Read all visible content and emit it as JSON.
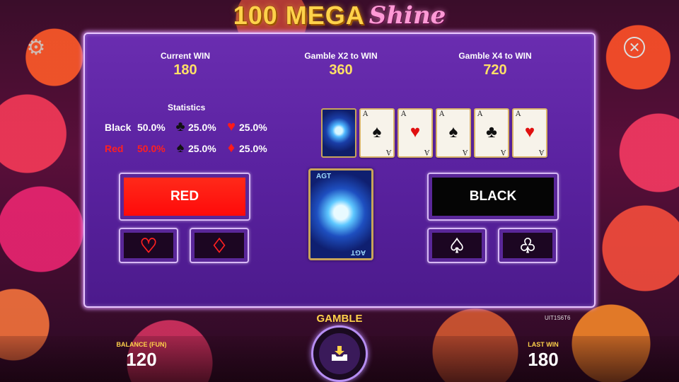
{
  "logo": {
    "part1": "100 MEGA",
    "part2": "Shine"
  },
  "header": {
    "current_win_label": "Current WIN",
    "current_win_value": "180",
    "gamble_x2_label": "Gamble X2 to WIN",
    "gamble_x2_value": "360",
    "gamble_x4_label": "Gamble X4 to WIN",
    "gamble_x4_value": "720"
  },
  "statistics": {
    "title": "Statistics",
    "rows": [
      {
        "name": "Black",
        "pct": "50.0%",
        "suit_a": "♣",
        "suit_a_pct": "25.0%",
        "suit_b": "♥",
        "suit_b_pct": "25.0%"
      },
      {
        "name": "Red",
        "pct": "50.0%",
        "suit_a": "♠",
        "suit_a_pct": "25.0%",
        "suit_b": "♦",
        "suit_b_pct": "25.0%"
      }
    ]
  },
  "history": [
    {
      "rank": "A",
      "suit": "♠",
      "color": "#111111"
    },
    {
      "rank": "A",
      "suit": "♥",
      "color": "#e01010"
    },
    {
      "rank": "A",
      "suit": "♠",
      "color": "#111111"
    },
    {
      "rank": "A",
      "suit": "♣",
      "color": "#111111"
    },
    {
      "rank": "A",
      "suit": "♥",
      "color": "#e01010"
    }
  ],
  "card_back_mark": "AGT",
  "buttons": {
    "red_label": "RED",
    "black_label": "BLACK",
    "heart": "♡",
    "diamond": "♢",
    "spade": "♤",
    "club": "♧"
  },
  "footer": {
    "gamble_label": "GAMBLE",
    "balance_label": "BALANCE (FUN)",
    "balance_value": "120",
    "last_win_label": "LAST WIN",
    "last_win_value": "180",
    "uid": "UIT1S6T6"
  },
  "icons": {
    "settings": "gear-icon",
    "close": "close-icon",
    "gamble": "collect-tray-icon"
  },
  "colors": {
    "panel": "#5a22a0",
    "accent_gold": "#ffe066",
    "red_button": "#ff1a0a",
    "black_button": "#050505"
  }
}
